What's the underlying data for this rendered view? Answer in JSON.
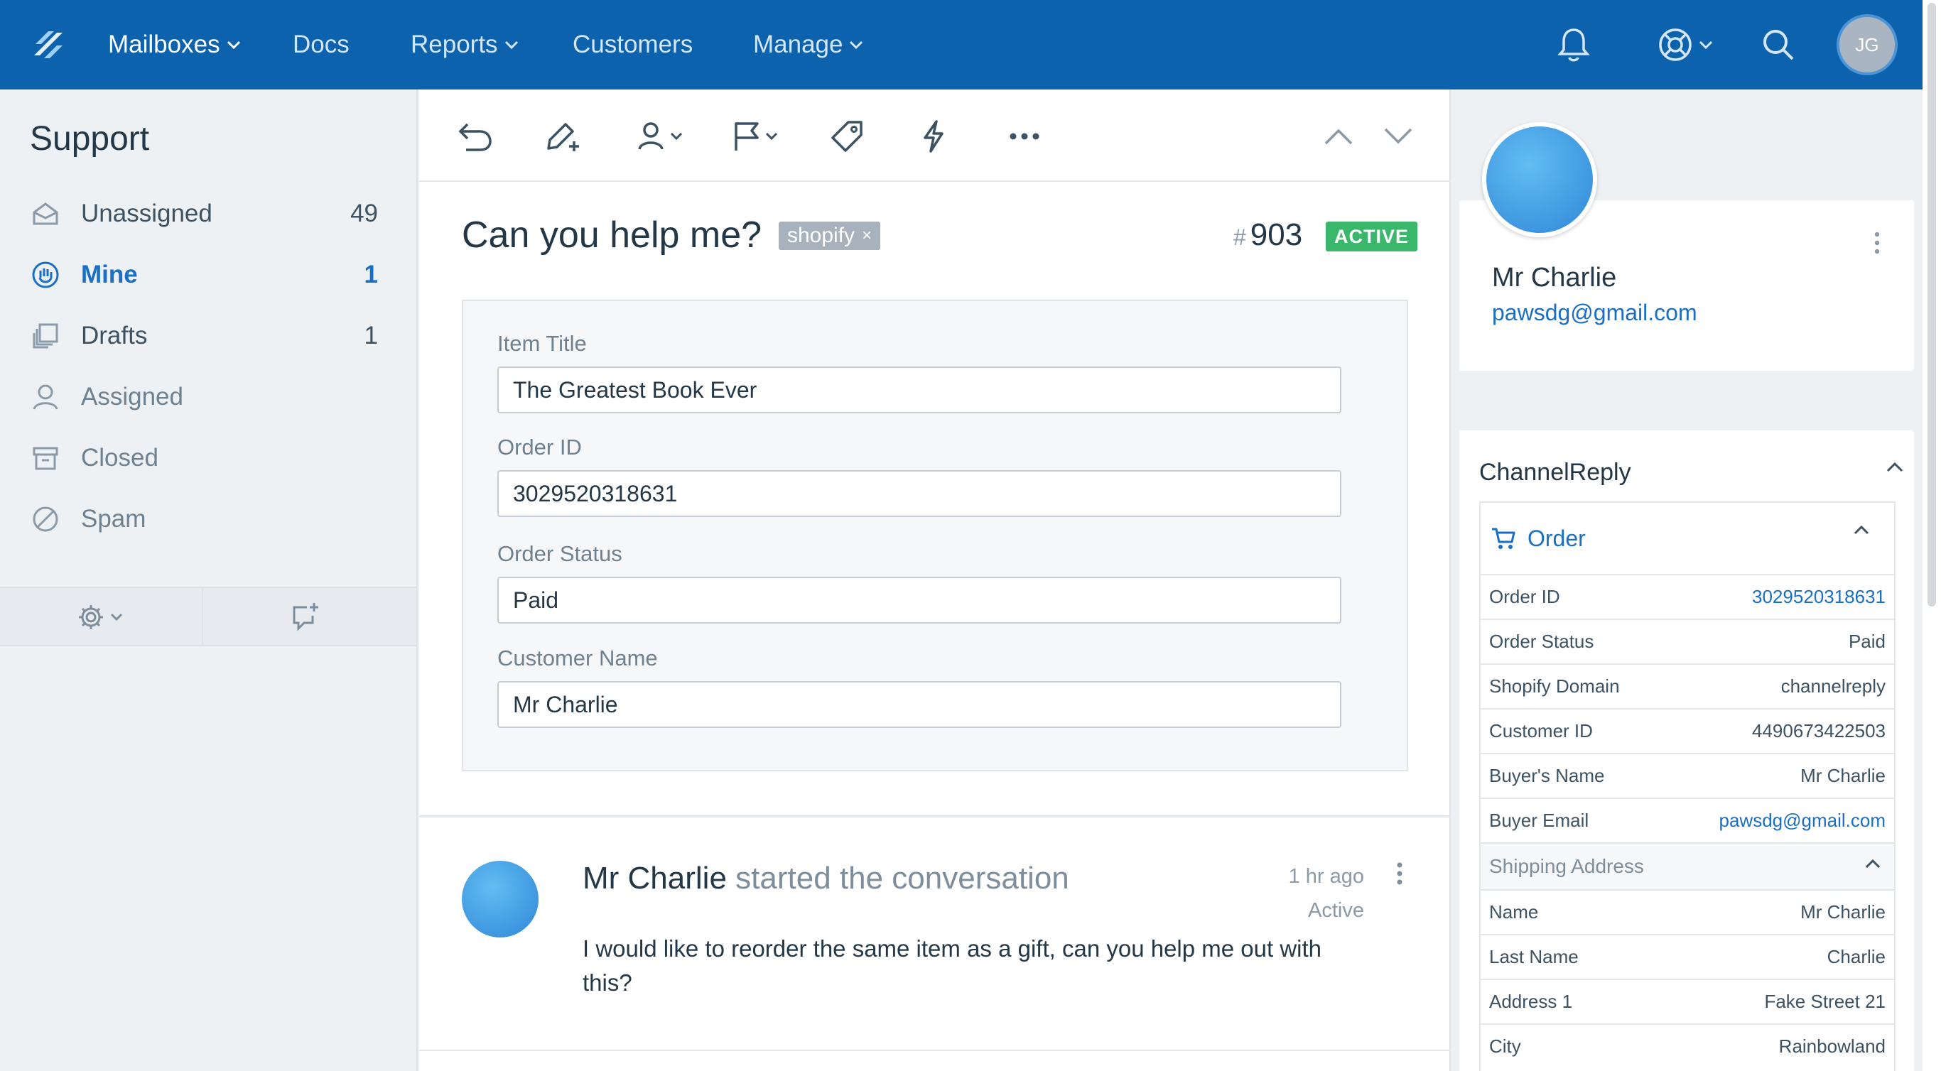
{
  "nav": {
    "items": [
      "Mailboxes",
      "Docs",
      "Reports",
      "Customers",
      "Manage"
    ],
    "avatar_initials": "JG"
  },
  "sidebar": {
    "title": "Support",
    "items": [
      {
        "label": "Unassigned",
        "count": "49"
      },
      {
        "label": "Mine",
        "count": "1"
      },
      {
        "label": "Drafts",
        "count": "1"
      },
      {
        "label": "Assigned",
        "count": ""
      },
      {
        "label": "Closed",
        "count": ""
      },
      {
        "label": "Spam",
        "count": ""
      }
    ]
  },
  "conversation": {
    "subject": "Can you help me?",
    "tag": "shopify",
    "tag_remove": "×",
    "hash": "#",
    "number": "903",
    "status": "ACTIVE"
  },
  "form": {
    "fields": [
      {
        "label": "Item Title",
        "value": "The Greatest Book Ever"
      },
      {
        "label": "Order ID",
        "value": "3029520318631"
      },
      {
        "label": "Order Status",
        "value": "Paid"
      },
      {
        "label": "Customer Name",
        "value": "Mr Charlie"
      }
    ]
  },
  "message": {
    "author": "Mr Charlie",
    "verb": "started the conversation",
    "time": "1 hr ago",
    "state": "Active",
    "body": "I would like to reorder the same item as a gift, can you help me out with this?"
  },
  "customer": {
    "name": "Mr Charlie",
    "email": "pawsdg@gmail.com"
  },
  "channelreply": {
    "title": "ChannelReply",
    "order_title": "Order",
    "rows": [
      {
        "k": "Order ID",
        "v": "3029520318631"
      },
      {
        "k": "Order Status",
        "v": "Paid"
      },
      {
        "k": "Shopify Domain",
        "v": "channelreply"
      },
      {
        "k": "Customer ID",
        "v": "4490673422503"
      },
      {
        "k": "Buyer's Name",
        "v": "Mr Charlie"
      },
      {
        "k": "Buyer Email",
        "v": "pawsdg@gmail.com"
      }
    ],
    "shipping_title": "Shipping Address",
    "shipping_rows": [
      {
        "k": "Name",
        "v": "Mr Charlie"
      },
      {
        "k": "Last Name",
        "v": "Charlie"
      },
      {
        "k": "Address 1",
        "v": "Fake Street 21"
      },
      {
        "k": "City",
        "v": "Rainbowland"
      }
    ]
  },
  "colors": {
    "nav_bg": "#0d62ad",
    "accent": "#1a6fc5",
    "status_active": "#3ab76a"
  }
}
